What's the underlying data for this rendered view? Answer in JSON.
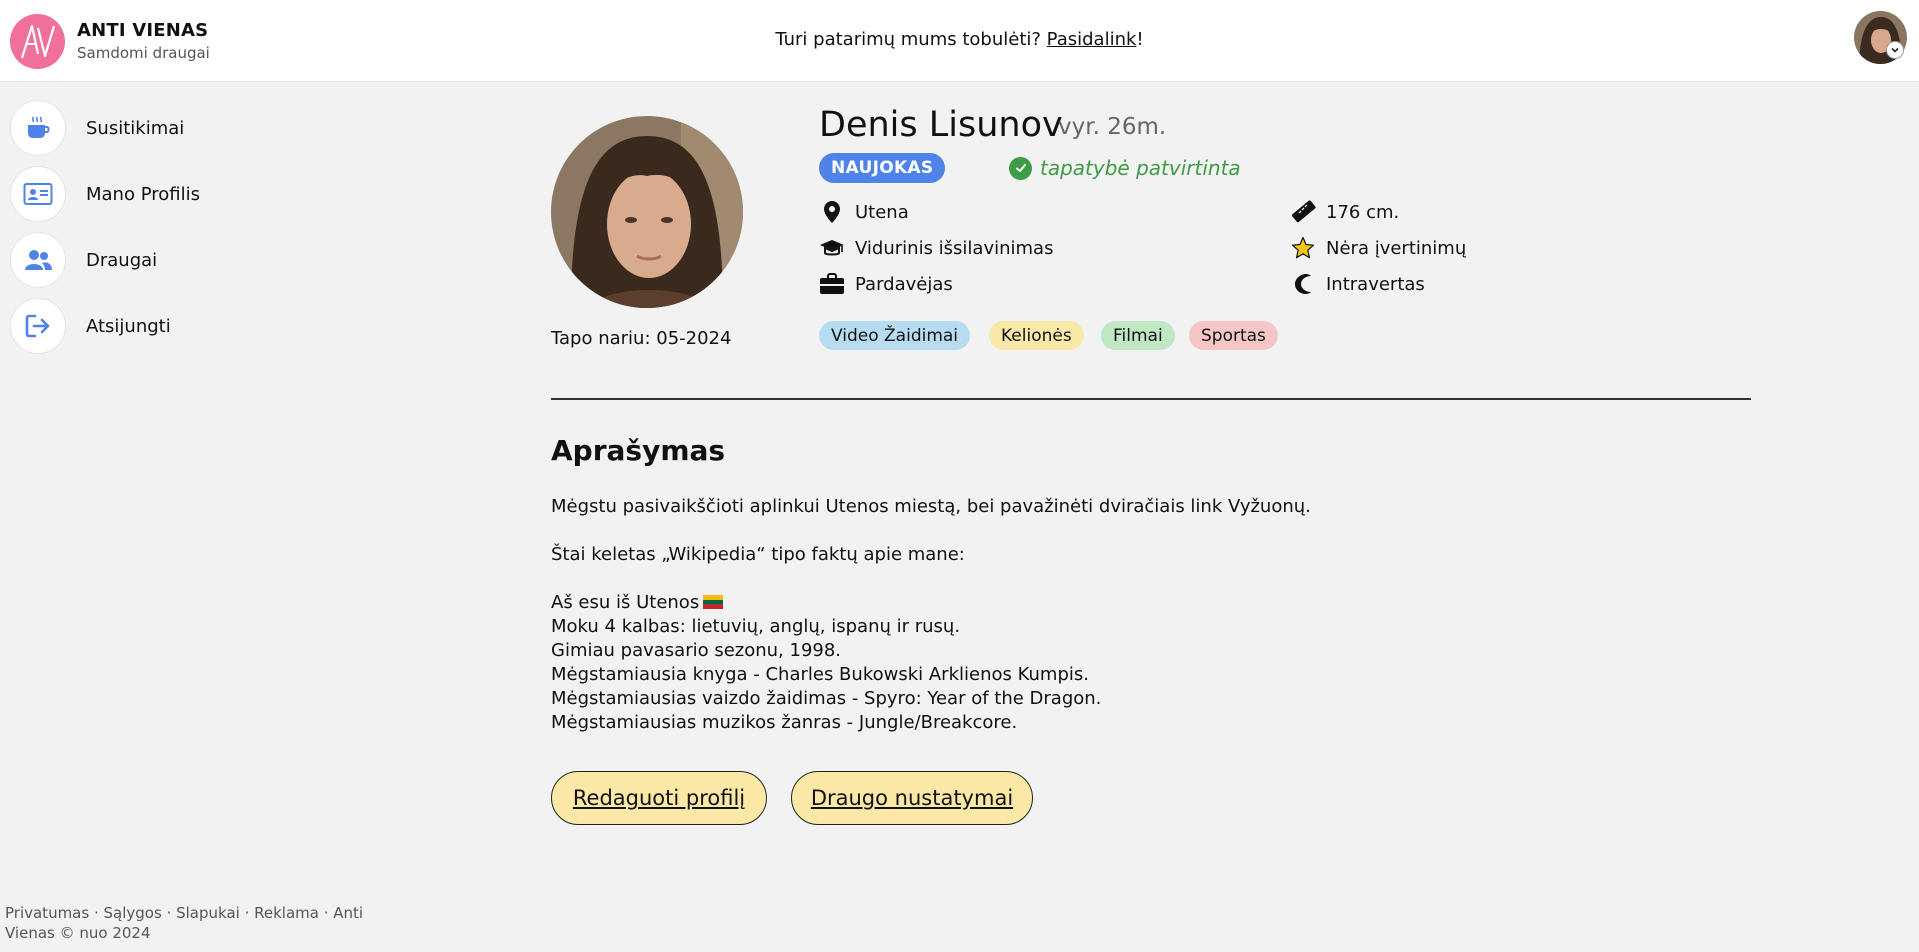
{
  "brand": {
    "title": "ANTI VIENAS",
    "subtitle": "Samdomi draugai"
  },
  "header": {
    "feedback_text": "Turi patarimų mums tobulėti? ",
    "feedback_link": "Pasidalink",
    "feedback_suffix": "!"
  },
  "sidebar": {
    "items": [
      {
        "label": "Susitikimai",
        "icon": "coffee-cup-icon"
      },
      {
        "label": "Mano Profilis",
        "icon": "id-card-icon"
      },
      {
        "label": "Draugai",
        "icon": "users-icon"
      },
      {
        "label": "Atsijungti",
        "icon": "logout-icon"
      }
    ]
  },
  "profile": {
    "name": "Denis Lisunov",
    "age": "vyr. 26m.",
    "badge": "NAUJOKAS",
    "verified": "tapatybė patvirtinta",
    "member_since": "Tapo nariu: 05-2024",
    "city": "Utena",
    "education": "Vidurinis išsilavinimas",
    "occupation": "Pardavėjas",
    "height": "176 cm.",
    "rating": "Nėra įvertinimų",
    "personality": "Intravertas",
    "interests": [
      "Video Žaidimai",
      "Kelionės",
      "Filmai",
      "Sportas"
    ]
  },
  "description": {
    "title": "Aprašymas",
    "intro": "Mėgstu pasivaikščioti aplinkui Utenos miestą, bei pavažinėti dviračiais link Vyžuonų.",
    "facts_intro": "Štai keletas „Wikipedia“ tipo faktų apie mane:",
    "facts": [
      "Aš esu iš Utenos",
      "Moku 4 kalbas: lietuvių, anglų, ispanų ir rusų.",
      "Gimiau pavasario sezonu, 1998.",
      "Mėgstamiausia knyga - Charles Bukowski Arklienos Kumpis.",
      "Mėgstamiausias vaizdo žaidimas - Spyro: Year of the Dragon.",
      "Mėgstamiausias muzikos žanras - Jungle/Breakcore."
    ]
  },
  "actions": {
    "edit_profile": "Redaguoti profilį",
    "friend_settings": "Draugo nustatymai"
  },
  "footer": {
    "links": [
      "Privatumas",
      "Sąlygos",
      "Slapukai",
      "Reklama"
    ],
    "separator": " · ",
    "copyright": "Anti Vienas © nuo 2024"
  },
  "colors": {
    "accent": "#4f83e8",
    "logo": "#f0709a",
    "verified": "#3e9b46",
    "button": "#fbe8a6",
    "tag_games": "#b7dcf2",
    "tag_travel": "#f8e9a8",
    "tag_movies": "#bfe8c3",
    "tag_sports": "#f6c6c6"
  }
}
